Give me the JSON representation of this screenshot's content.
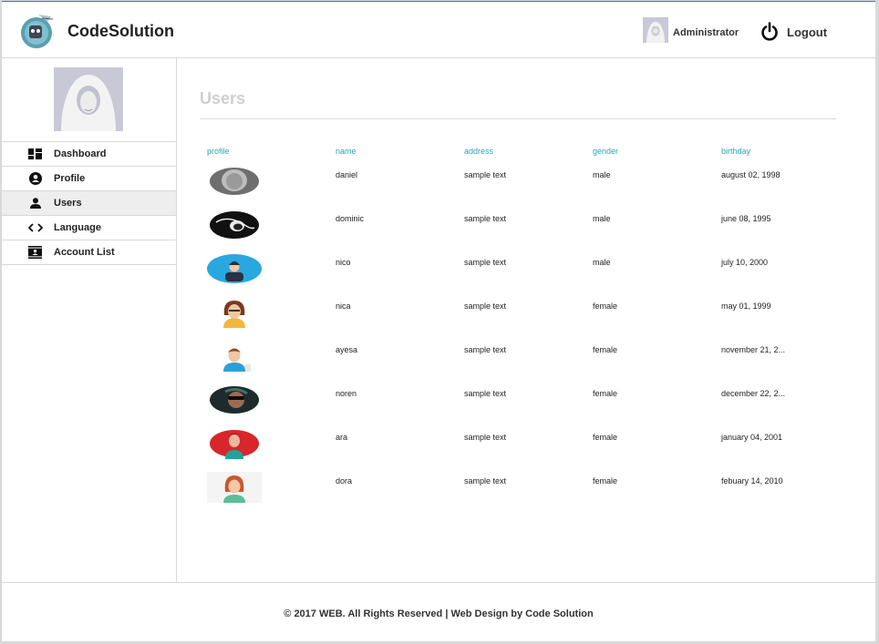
{
  "header": {
    "brand": "CodeSolution",
    "user_name": "Administrator",
    "logout_label": "Logout"
  },
  "sidebar": {
    "items": [
      {
        "label": "Dashboard",
        "icon": "dashboard-icon"
      },
      {
        "label": "Profile",
        "icon": "account-circle-icon"
      },
      {
        "label": "Users",
        "icon": "person-icon",
        "active": true
      },
      {
        "label": "Language",
        "icon": "code-icon"
      },
      {
        "label": "Account List",
        "icon": "contact-card-icon"
      }
    ]
  },
  "main": {
    "title": "Users",
    "columns": [
      "profile",
      "name",
      "address",
      "gender",
      "birthday"
    ],
    "rows": [
      {
        "name": "daniel",
        "address": "sample text",
        "gender": "male",
        "birthday": "august 02, 1998"
      },
      {
        "name": "dominic",
        "address": "sample text",
        "gender": "male",
        "birthday": "june 08, 1995"
      },
      {
        "name": "nico",
        "address": "sample text",
        "gender": "male",
        "birthday": "july 10, 2000"
      },
      {
        "name": "nica",
        "address": "sample text",
        "gender": "female",
        "birthday": "may 01, 1999"
      },
      {
        "name": "ayesa",
        "address": "sample text",
        "gender": "female",
        "birthday": "november 21, 2..."
      },
      {
        "name": "noren",
        "address": "sample text",
        "gender": "female",
        "birthday": "december 22, 2..."
      },
      {
        "name": "ara",
        "address": "sample text",
        "gender": "female",
        "birthday": "january 04, 2001"
      },
      {
        "name": "dora",
        "address": "sample text",
        "gender": "female",
        "birthday": "febuary 14, 2010"
      }
    ]
  },
  "footer": {
    "text": "© 2017 WEB. All Rights Reserved | Web Design by Code Solution"
  },
  "colors": {
    "accent": "#2aa3b8",
    "title_muted": "#cfcfcf",
    "active_nav_bg": "#eeeeee"
  }
}
